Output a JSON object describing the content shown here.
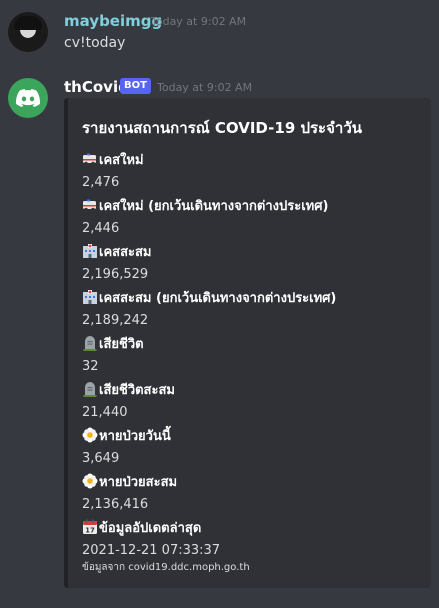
{
  "messages": [
    {
      "username": "maybeimgg",
      "timestamp": "Today at 9:02 AM",
      "content": "cv!today"
    },
    {
      "username": "thCovid",
      "badge": "BOT",
      "timestamp": "Today at 9:02 AM",
      "embed": {
        "title": "รายงานสถานการณ์ COVID-19 ประจำวัน",
        "fields": [
          {
            "icon": "ambulance-icon",
            "name": "เคสใหม่",
            "value": "2,476"
          },
          {
            "icon": "ambulance-icon",
            "name": "เคสใหม่ (ยกเว้นเดินทางจากต่างประเทศ)",
            "value": "2,446"
          },
          {
            "icon": "hospital-icon",
            "name": "เคสสะสม",
            "value": "2,196,529"
          },
          {
            "icon": "hospital-icon",
            "name": "เคสสะสม (ยกเว้นเดินทางจากต่างประเทศ)",
            "value": "2,189,242"
          },
          {
            "icon": "headstone-icon",
            "name": "เสียชีวิต",
            "value": "32"
          },
          {
            "icon": "headstone-icon",
            "name": "เสียชีวิตสะสม",
            "value": "21,440"
          },
          {
            "icon": "flower-icon",
            "name": "หายป่วยวันนี้",
            "value": "3,649"
          },
          {
            "icon": "flower-icon",
            "name": "หายป่วยสะสม",
            "value": "2,136,416"
          },
          {
            "icon": "calendar-icon",
            "name": "ข้อมูลอัปเดตล่าสุด",
            "value": "2021-12-21 07:33:37"
          }
        ],
        "footer": "ข้อมูลจาก covid19.ddc.moph.go.th"
      }
    }
  ],
  "colors": {
    "background": "#36393f",
    "embed_background": "#2f3136",
    "user_name": "#7fd0dc",
    "bot_badge": "#5865f2",
    "bot_avatar": "#3ba55c"
  }
}
